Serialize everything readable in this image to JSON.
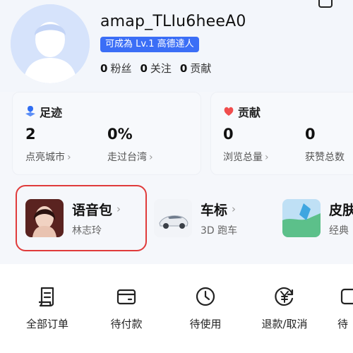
{
  "profile": {
    "username": "amap_TLIu6heeA0",
    "level_badge": "可成為 Lv.1 高德達人",
    "fans": {
      "count": "0",
      "label": "粉丝"
    },
    "following": {
      "count": "0",
      "label": "关注"
    },
    "contributions": {
      "count": "0",
      "label": "贡献"
    }
  },
  "footprint": {
    "title": "足迹",
    "cities": {
      "value": "2",
      "label": "点亮城市"
    },
    "taiwan": {
      "value": "0%",
      "label": "走过台湾"
    }
  },
  "contribution": {
    "title": "贡献",
    "views": {
      "value": "0",
      "label": "浏览总量"
    },
    "likes": {
      "value": "0",
      "label": "获赞总数"
    }
  },
  "features": {
    "voice": {
      "title": "语音包",
      "subtitle": "林志玲"
    },
    "car": {
      "title": "车标",
      "subtitle": "3D 跑车"
    },
    "skin": {
      "title": "皮肤",
      "subtitle": "经典"
    }
  },
  "orders": {
    "all": "全部订单",
    "pending_payment": "待付款",
    "to_use": "待使用",
    "refund": "退款/取消",
    "more": "待"
  },
  "colors": {
    "badge_blue": "#3b6ef6",
    "highlight_red": "#e03b3b",
    "page_bg": "#f5f7fb"
  }
}
